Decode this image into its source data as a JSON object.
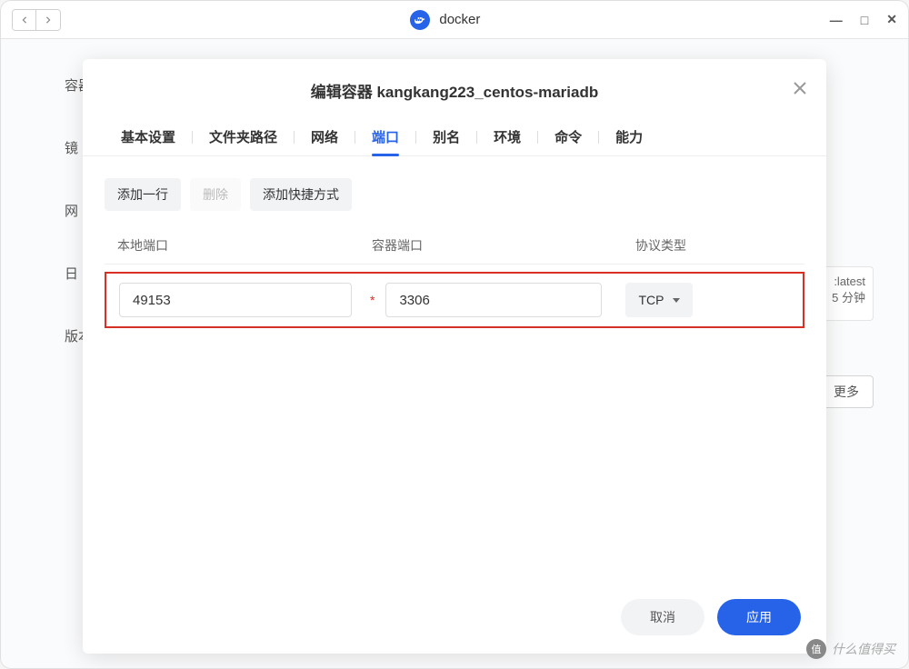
{
  "window": {
    "title": "docker"
  },
  "sidebar": {
    "items": [
      "容器",
      "镜",
      "网",
      "日",
      "版本"
    ]
  },
  "background": {
    "tag": ":latest",
    "time": "5 分钟",
    "more": "更多"
  },
  "modal": {
    "title": "编辑容器 kangkang223_centos-mariadb",
    "tabs": [
      "基本设置",
      "文件夹路径",
      "网络",
      "端口",
      "别名",
      "环境",
      "命令",
      "能力"
    ],
    "active_tab": 3,
    "toolbar": {
      "add_row": "添加一行",
      "delete": "删除",
      "add_shortcut": "添加快捷方式"
    },
    "columns": {
      "local_port": "本地端口",
      "container_port": "容器端口",
      "protocol": "协议类型"
    },
    "row": {
      "local_port": "49153",
      "container_port": "3306",
      "protocol": "TCP"
    },
    "footer": {
      "cancel": "取消",
      "apply": "应用"
    }
  },
  "watermark": "什么值得买"
}
